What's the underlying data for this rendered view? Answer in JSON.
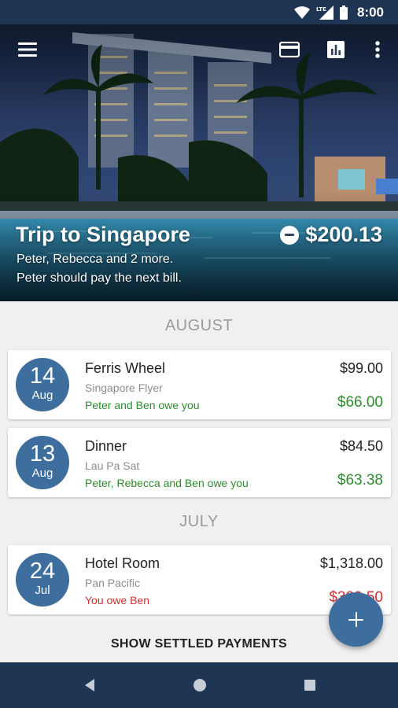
{
  "status_bar": {
    "time": "8:00",
    "icons": [
      "wifi-icon",
      "lte-signal-icon",
      "battery-icon"
    ]
  },
  "toolbar": {
    "icons": [
      "menu-icon",
      "credit-card-icon",
      "bar-chart-icon",
      "more-vert-icon"
    ]
  },
  "trip": {
    "title": "Trip to Singapore",
    "members": "Peter, Rebecca and 2 more.",
    "next_payer": "Peter should pay the next bill.",
    "balance": "$200.13",
    "balance_icon": "minus-circle-icon"
  },
  "sections": [
    {
      "month": "AUGUST",
      "expenses": [
        {
          "day": "14",
          "month": "Aug",
          "title": "Ferris Wheel",
          "place": "Singapore Flyer",
          "owe_text": "Peter and Ben owe you",
          "total": "$99.00",
          "share": "$66.00"
        },
        {
          "day": "13",
          "month": "Aug",
          "title": "Dinner",
          "place": "Lau Pa Sat",
          "owe_text": "Peter, Rebecca and Ben owe you",
          "total": "$84.50",
          "share": "$63.38"
        }
      ]
    },
    {
      "month": "JULY",
      "expenses": [
        {
          "day": "24",
          "month": "Jul",
          "title": "Hotel Room",
          "place": "Pan Pacific",
          "owe_text": "You owe Ben",
          "total": "$1,318.00",
          "share": "$329.50"
        }
      ]
    }
  ],
  "show_settled_label": "SHOW SETTLED PAYMENTS",
  "fab_icon": "plus-icon",
  "colors": {
    "primary_dark": "#1f3554",
    "accent": "#3d6e9e",
    "positive": "#2e8b2e",
    "negative": "#d32f2f"
  },
  "nav_bar": {
    "icons": [
      "back-icon",
      "home-icon",
      "recents-icon"
    ]
  }
}
